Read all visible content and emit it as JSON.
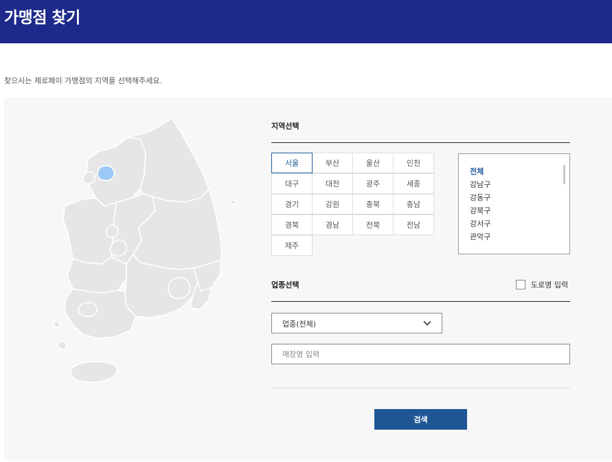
{
  "header": {
    "title": "가맹점 찾기"
  },
  "guide_text": "찾으시는 제로페이 가맹점의 지역을 선택해주세요.",
  "region": {
    "title": "지역선택",
    "cities": [
      "서울",
      "부산",
      "울산",
      "인천",
      "대구",
      "대전",
      "광주",
      "세종",
      "경기",
      "강원",
      "충북",
      "충남",
      "경북",
      "경남",
      "전북",
      "전남",
      "제주"
    ],
    "selected": "서울"
  },
  "districts": {
    "items": [
      "전체",
      "강남구",
      "강동구",
      "강북구",
      "강서구",
      "관악구"
    ],
    "selected": "전체"
  },
  "category": {
    "title": "업종선택",
    "road_name_label": "도로명 입력",
    "road_name_checked": false,
    "select_value": "업종(전체)"
  },
  "store_name": {
    "placeholder": "매장명 입력"
  },
  "search_button": {
    "label": "검색"
  },
  "colors": {
    "header_bg": "#1e2a8a",
    "accent": "#1e5a9a",
    "button_bg": "#1f5693",
    "map_land": "#e6e6e6",
    "map_selected": "#9cc8f5"
  }
}
